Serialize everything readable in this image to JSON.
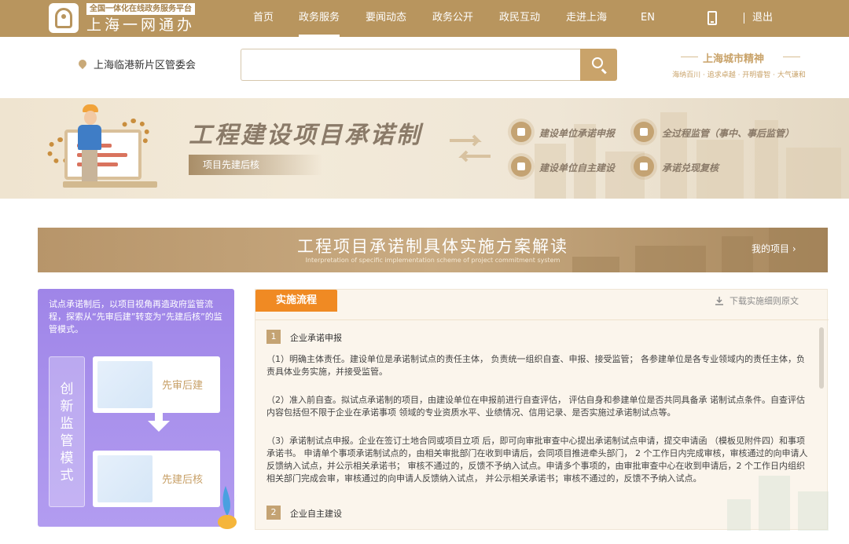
{
  "header": {
    "tagline": "全国一体化在线政务服务平台",
    "brand": "上海一网通办",
    "nav": [
      {
        "label": "首页",
        "active": false
      },
      {
        "label": "政务服务",
        "active": true
      },
      {
        "label": "要闻动态",
        "active": false
      },
      {
        "label": "政务公开",
        "active": false
      },
      {
        "label": "政民互动",
        "active": false
      },
      {
        "label": "走进上海",
        "active": false
      },
      {
        "label": "EN",
        "active": false
      }
    ],
    "logout": "退出"
  },
  "search": {
    "location": "上海临港新片区管委会",
    "placeholder": "",
    "spirit_title": "上海城市精神",
    "spirit_sub": "海纳百川 · 追求卓越 · 开明睿智 · 大气谦和"
  },
  "banner": {
    "title": "工程建设项目承诺制",
    "subtitle": "项目先建后核",
    "features": [
      "建设单位承诺申报",
      "全过程监管（事中、事后监管）",
      "建设单位自主建设",
      "承诺兑现复核"
    ]
  },
  "interp": {
    "title": "工程项目承诺制具体实施方案解读",
    "subtitle": "Interpretation of specific implementation scheme of project commitment system",
    "my_project": "我的项目 ›"
  },
  "left_panel": {
    "intro": "试点承诺制后，以项目视角再造政府监管流程，探索从“先审后建”转变为“先建后核”的监管模式。",
    "mode_label": "创新监管模式",
    "cards": [
      "先审后建",
      "先建后核"
    ]
  },
  "right_panel": {
    "tab": "实施流程",
    "download": "下载实施细则原文",
    "steps": [
      {
        "num": "1",
        "title": "企业承诺申报"
      },
      {
        "num": "2",
        "title": "企业自主建设"
      }
    ],
    "paragraphs": [
      "（1）明确主体责任。建设单位是承诺制试点的责任主体， 负责统一组织自查、申报、接受监管； 各参建单位是各专业领域内的责任主体，负责具体业务实施，并接受监管。",
      "（2）准入前自查。拟试点承诺制的项目，由建设单位在申报前进行自查评估， 评估自身和参建单位是否共同具备承 诺制试点条件。自查评估内容包括但不限于企业在承诺事项 领域的专业资质水平、业绩情况、信用记录、是否实施过承诺制试点等。",
      "（3）承诺制试点申报。企业在签订土地合同或项目立项 后，即可向审批审查中心提出承诺制试点申请，提交申请函 （模板见附件四）和事项承诺书。 申请单个事项承诺制试点的，由相关审批部门在收到申请后，会同项目推进牵头部门， 2 个工作日内完成审核，审核通过的向申请人反馈纳入试点，并公示相关承诺书； 审核不通过的，反馈不予纳入试点。申请多个事项的，由审批审查中心在收到申请后，2 个工作日内组织相关部门完成会审，审核通过的向申请人反馈纳入试点， 并公示相关承诺书；审核不通过的，反馈不予纳入试点。"
    ]
  }
}
